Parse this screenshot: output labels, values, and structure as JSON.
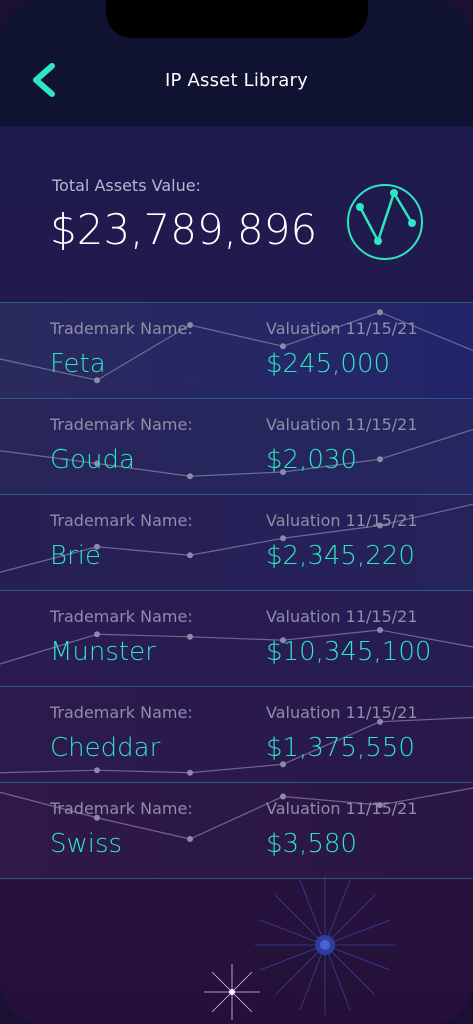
{
  "header": {
    "title": "IP Asset Library"
  },
  "summary": {
    "label": "Total Assets Value:",
    "value": "$23,789,896"
  },
  "rows": [
    {
      "name_label": "Trademark Name:",
      "name": "Feta",
      "valuation_label": "Valuation 11/15/21",
      "valuation": "$245,000",
      "trend": [
        0.6,
        0.85,
        0.2,
        0.45,
        0.05,
        0.5
      ]
    },
    {
      "name_label": "Trademark Name:",
      "name": "Gouda",
      "valuation_label": "Valuation 11/15/21",
      "valuation": "$2,030",
      "trend": [
        0.55,
        0.7,
        0.85,
        0.8,
        0.65,
        0.3
      ]
    },
    {
      "name_label": "Trademark Name:",
      "name": "Brie",
      "valuation_label": "Valuation 11/15/21",
      "valuation": "$2,345,220",
      "trend": [
        0.85,
        0.55,
        0.65,
        0.45,
        0.3,
        0.05
      ]
    },
    {
      "name_label": "Trademark Name:",
      "name": "Munster",
      "valuation_label": "Valuation 11/15/21",
      "valuation": "$10,345,100",
      "trend": [
        0.8,
        0.45,
        0.48,
        0.52,
        0.4,
        0.6
      ]
    },
    {
      "name_label": "Trademark Name:",
      "name": "Cheddar",
      "valuation_label": "Valuation 11/15/21",
      "valuation": "$1,375,550",
      "trend": [
        0.95,
        0.92,
        0.95,
        0.85,
        0.35,
        0.3
      ]
    },
    {
      "name_label": "Trademark Name:",
      "name": "Swiss",
      "valuation_label": "Valuation 11/15/21",
      "valuation": "$3,580",
      "trend": [
        0.05,
        0.35,
        0.6,
        0.1,
        0.2,
        0.0
      ]
    }
  ],
  "colors": {
    "accent": "#2ee6c2",
    "nav_bg": "#0f1230",
    "divider": "#2d5a7e",
    "muted": "#8f8da8"
  },
  "icons": {
    "back": "chevron-left-icon",
    "summary": "line-chart-circle-icon"
  }
}
